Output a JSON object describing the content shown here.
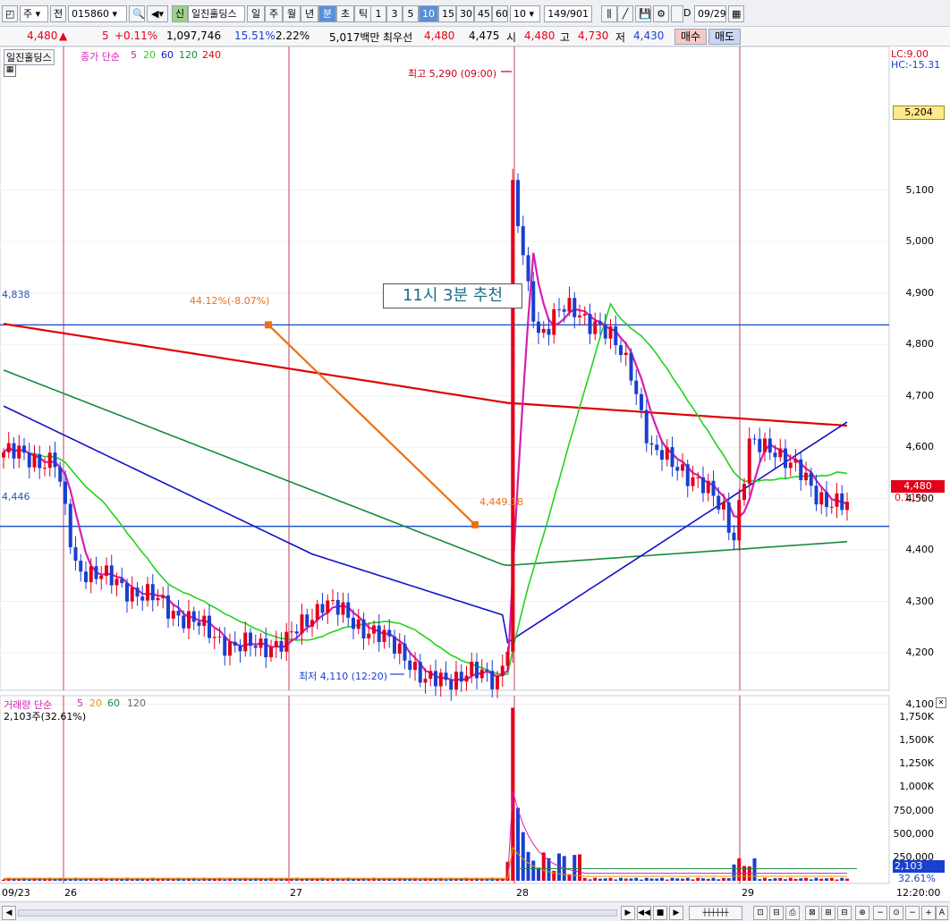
{
  "toolbar": {
    "market": "주",
    "prev_label": "전",
    "code": "015860",
    "stock_badge": "신",
    "stock_name": "일진홀딩스",
    "periods": [
      "일",
      "주",
      "월",
      "년",
      "분",
      "초",
      "틱"
    ],
    "selected_period": "분",
    "intervals": [
      "1",
      "3",
      "5",
      "10",
      "15",
      "30",
      "45",
      "60"
    ],
    "selected_interval": "10",
    "interval_value": "10",
    "page_counter": "149/901",
    "date_prefix": "D",
    "date": "09/29"
  },
  "quote": {
    "price": "4,480",
    "arrow": "▲",
    "change": "5",
    "change_pct": "+0.11%",
    "volume": "1,097,746",
    "vol_ratio": "15.51%",
    "turnover_pct": "2.22%",
    "amount": "5,017백만",
    "best_label": "최우선",
    "best_ask": "4,480",
    "best_bid": "4,475",
    "open_label": "시",
    "open": "4,480",
    "high_label": "고",
    "high": "4,730",
    "low_label": "저",
    "low": "4,430",
    "buy_label": "매수",
    "sell_label": "매도"
  },
  "price_panel": {
    "name": "일진홀딩스",
    "ma_label": "종가 단순",
    "ma_periods": [
      "5",
      "20",
      "60",
      "120",
      "240"
    ],
    "lc": "LC:9.00",
    "hc": "HC:-15.31",
    "ref_price_box": "5,204",
    "current_box": "4,480",
    "current_pct": "0.11%",
    "hline_high_label": "4,838",
    "hline_low_label": "4,446",
    "max_annotation": "최고 5,290 (09:00)",
    "min_annotation": "최저 4,110 (12:20)",
    "trend_start_label": "44.12%(-8.07%)",
    "trend_end_label": "4,449.18",
    "note_box": "11시  3분  추천",
    "y_ticks": [
      "5,100",
      "5,000",
      "4,900",
      "4,800",
      "4,700",
      "4,600",
      "4,500",
      "4,400",
      "4,300",
      "4,200",
      "4,100"
    ]
  },
  "volume_panel": {
    "label": "거래량 단순",
    "ma_periods": [
      "5",
      "20",
      "60",
      "120"
    ],
    "current": "2,103주(32.61%)",
    "y_ticks": [
      "1,750K",
      "1,500K",
      "1,250K",
      "1,000K",
      "750,000",
      "500,000",
      "250,000"
    ],
    "current_box": "2,103",
    "current_pct": "32.61%"
  },
  "x_axis": {
    "labels": [
      "09/23",
      "26",
      "27",
      "28",
      "29"
    ],
    "time": "12:20:00"
  },
  "colors": {
    "up": "#e3001b",
    "down": "#1a3fd1",
    "ma5": "#d61fb0",
    "ma20": "#22d31e",
    "ma60": "#1313c8",
    "ma120": "#178a3c",
    "ma240": "#e00000",
    "trend": "#f07010",
    "hline": "#2255cc"
  },
  "chart_data": {
    "type": "candlestick",
    "session_dates": [
      "09/23",
      "09/26",
      "09/27",
      "09/28",
      "09/29"
    ],
    "price_range": [
      4080,
      5300
    ],
    "annotated_extremes": {
      "high": 5290,
      "high_time": "09:00",
      "low": 4110,
      "low_time": "12:20"
    },
    "horizontal_lines": [
      4838,
      4446
    ],
    "trend_line": {
      "start": 4838,
      "end": 4449.18
    },
    "close_anchors": [
      {
        "session": "09/23",
        "close": 4580
      },
      {
        "session": "09/26",
        "close": 4340
      },
      {
        "session": "09/27",
        "close": 4170
      },
      {
        "session": "09/28",
        "close": 4830
      },
      {
        "session": "09/29",
        "close": 4480
      }
    ],
    "volume_peak": 1850000,
    "last_volume": 2103
  }
}
